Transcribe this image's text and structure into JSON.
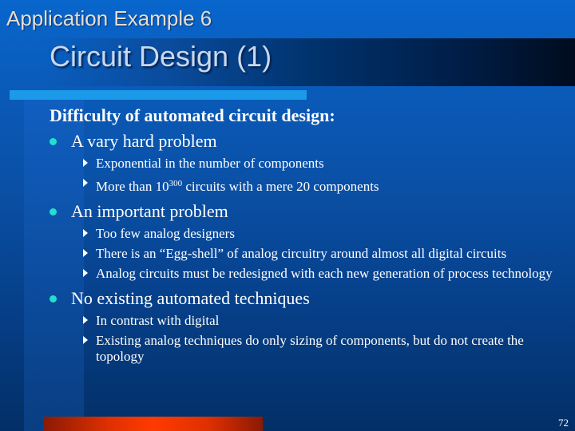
{
  "header": {
    "app_title": "Application Example 6",
    "slide_title": "Circuit Design (1)"
  },
  "body": {
    "heading": "Difficulty of automated circuit design:",
    "bullets": [
      {
        "text": "A vary hard problem",
        "subs": [
          {
            "text": "Exponential in the number of components"
          },
          {
            "pre": "More than 10",
            "sup": "300",
            "post": " circuits with a mere 20 components"
          }
        ]
      },
      {
        "text": "An important problem",
        "subs": [
          {
            "text": "Too few analog designers"
          },
          {
            "text": "There is an “Egg-shell” of analog circuitry around almost all digital circuits"
          },
          {
            "text": "Analog circuits must be redesigned with each new generation of process technology"
          }
        ]
      },
      {
        "text": "No existing automated techniques",
        "subs": [
          {
            "text": "In contrast with digital"
          },
          {
            "text": "Existing analog techniques do only sizing of components, but do not create the topology"
          }
        ]
      }
    ]
  },
  "footer": {
    "page_number": "72"
  },
  "icons": {
    "level1_bullet": "cyan-dot-icon",
    "level2_bullet": "right-triangle-icon"
  },
  "colors": {
    "bullet_dot": "#22e0d0",
    "underline": "#1a9ae8",
    "footer_bar": "#ff3a00"
  }
}
